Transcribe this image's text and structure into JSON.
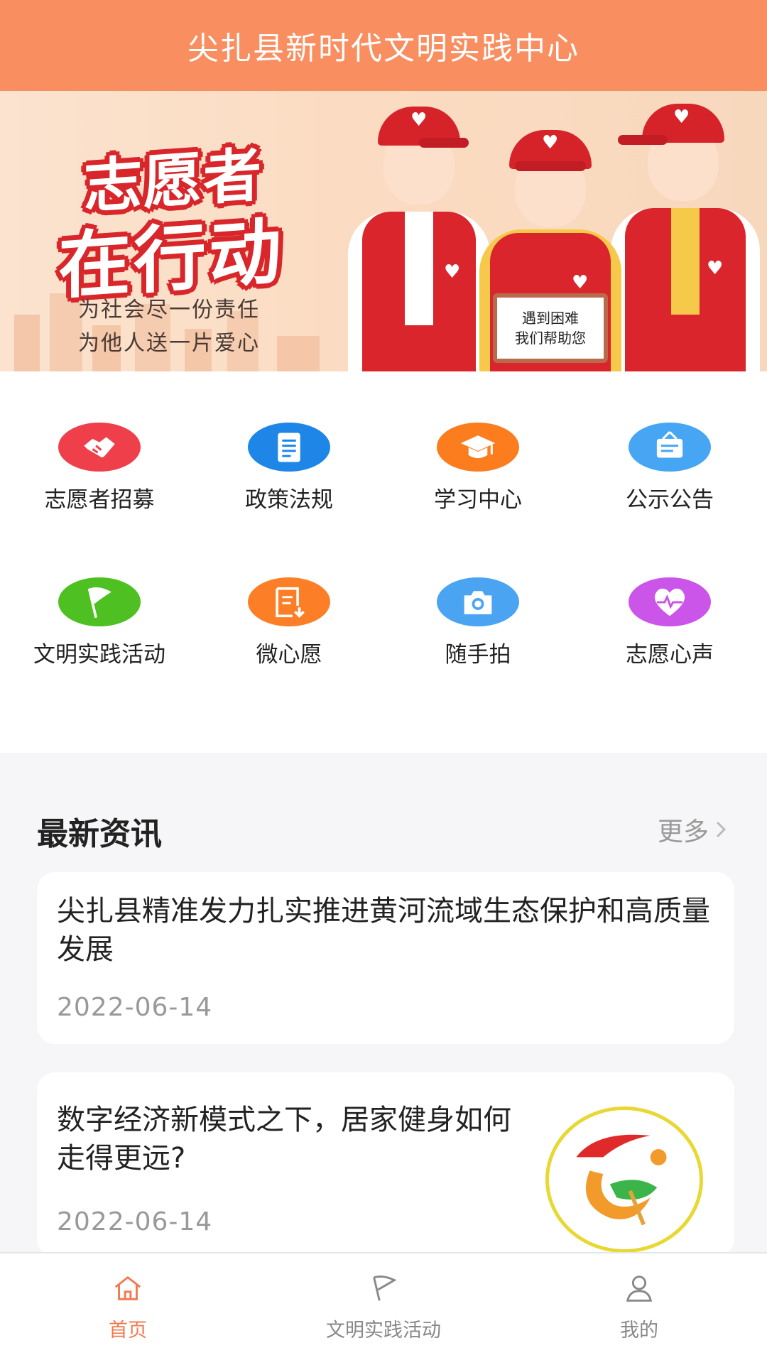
{
  "header": {
    "title": "尖扎县新时代文明实践中心"
  },
  "banner": {
    "headline_1": "志愿者",
    "headline_2": "在行动",
    "slogan_1": "为社会尽一份责任",
    "slogan_2": "为他人送一片爱心",
    "sign_line_1": "遇到困难",
    "sign_line_2": "我们帮助您"
  },
  "menu": [
    {
      "label": "志愿者招募",
      "icon": "handshake-icon",
      "color": "#ee3f4b"
    },
    {
      "label": "政策法规",
      "icon": "document-icon",
      "color": "#1d86e6"
    },
    {
      "label": "学习中心",
      "icon": "graduation-cap-icon",
      "color": "#fb7d1e"
    },
    {
      "label": "公示公告",
      "icon": "notice-board-icon",
      "color": "#46a6f3"
    },
    {
      "label": "文明实践活动",
      "icon": "flag-icon",
      "color": "#4ec021"
    },
    {
      "label": "微心愿",
      "icon": "wish-list-icon",
      "color": "#fc7f27"
    },
    {
      "label": "随手拍",
      "icon": "camera-icon",
      "color": "#4aa4f2"
    },
    {
      "label": "志愿心声",
      "icon": "heartbeat-icon",
      "color": "#cb55e8"
    }
  ],
  "news": {
    "heading": "最新资讯",
    "more": "更多",
    "items": [
      {
        "title": "尖扎县精准发力扎实推进黄河流域生态保护和高质量发展",
        "date": "2022-06-14"
      },
      {
        "title": "数字经济新模式之下，居家健身如何走得更远?",
        "date": "2022-06-14"
      }
    ]
  },
  "tabbar": {
    "items": [
      {
        "label": "首页",
        "icon": "home-icon",
        "active": true
      },
      {
        "label": "文明实践活动",
        "icon": "flag-icon",
        "active": false
      },
      {
        "label": "我的",
        "icon": "user-icon",
        "active": false
      }
    ]
  },
  "colors": {
    "accent": "#f98e61",
    "active_tab": "#f2794f"
  }
}
